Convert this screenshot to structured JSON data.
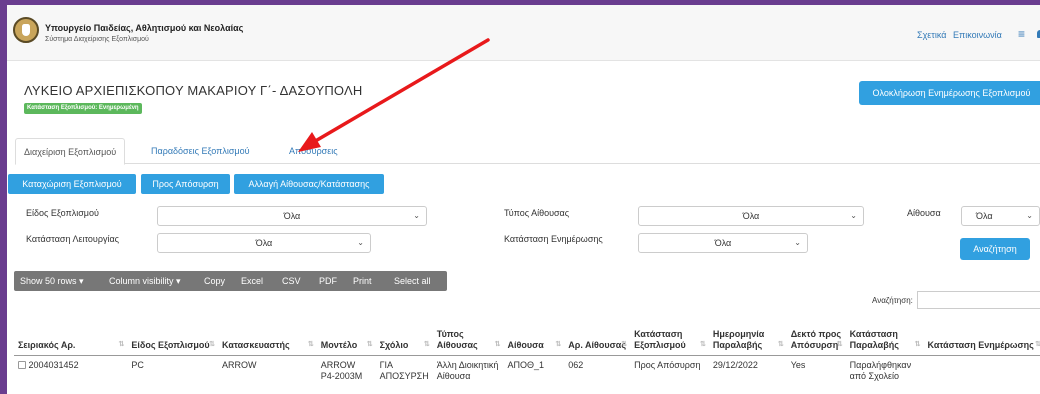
{
  "header": {
    "org_title": "Υπουργείο Παιδείας, Αθλητισμού και Νεολαίας",
    "org_subtitle": "Σύστημα Διαχείρισης Εξοπλισμού",
    "nav_about": "Σχετικά",
    "nav_contact": "Επικοινωνία"
  },
  "school": {
    "title": "ΛΥΚΕΙΟ ΑΡΧΙΕΠΙΣΚΟΠΟΥ ΜΑΚΑΡΙΟΥ Γ΄- ΔΑΣΟΥΠΟΛΗ",
    "status": "Κατάσταση Εξοπλισμού: Ενημερωμένη",
    "complete_button": "Ολοκλήρωση Ενημέρωσης Εξοπλισμού"
  },
  "tabs": [
    "Διαχείριση Εξοπλισμού",
    "Παραδόσεις Εξοπλισμού",
    "Αποσύρσεις"
  ],
  "actions": {
    "add": "Καταχώριση Εξοπλισμού",
    "withdraw": "Προς Απόσυρση",
    "change": "Αλλαγή Αίθουσας/Κατάστασης"
  },
  "filters": {
    "equipment_type": {
      "label": "Είδος Εξοπλισμού",
      "value": "Όλα"
    },
    "room_type": {
      "label": "Τύπος Αίθουσας",
      "value": "Όλα"
    },
    "room": {
      "label": "Αίθουσα",
      "value": "Όλα"
    },
    "operation_status": {
      "label": "Κατάσταση Λειτουργίας",
      "value": "Όλα"
    },
    "update_status": {
      "label": "Κατάσταση Ενημέρωσης",
      "value": "Όλα"
    },
    "search_button": "Αναζήτηση"
  },
  "toolbar": {
    "show_rows": "Show 50 rows ▾",
    "column_visibility": "Column visibility ▾",
    "copy": "Copy",
    "excel": "Excel",
    "csv": "CSV",
    "pdf": "PDF",
    "print": "Print",
    "select_all": "Select all",
    "search_label": "Αναζήτηση:"
  },
  "table": {
    "headers": [
      "Σειριακός Αρ.",
      "Είδος Εξοπλισμού",
      "Κατασκευαστής",
      "Μοντέλο",
      "Σχόλιο",
      "Τύπος Αίθουσας",
      "Αίθουσα",
      "Αρ. Αίθουσας",
      "Κατάσταση Εξοπλισμού",
      "Ημερομηνία Παραλαβής",
      "Δεκτό προς Απόσυρση",
      "Κατάσταση Παραλαβής",
      "Κατάσταση Ενημέρωσης"
    ],
    "rows": [
      [
        "2004031452",
        "PC",
        "ARROW",
        "ARROW P4-2003M",
        "ΓΙΑ ΑΠΟΣΥΡΣΗ",
        "Άλλη Διοικητική Αίθουσα",
        "ΑΠΟΘ_1",
        "062",
        "Προς Απόσυρση",
        "29/12/2022",
        "Yes",
        "Παραλήφθηκαν από Σχολείο",
        ""
      ]
    ]
  },
  "annotation_color": "#e8191b"
}
